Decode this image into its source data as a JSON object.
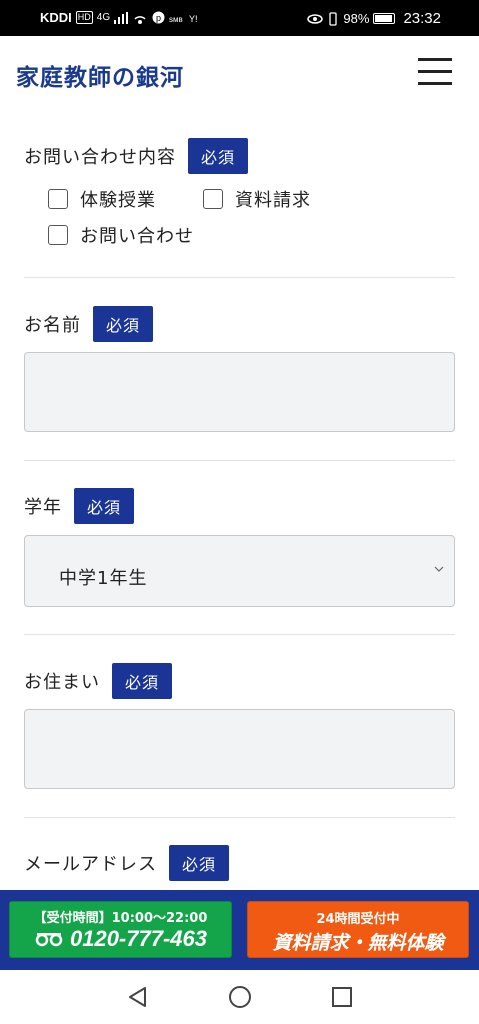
{
  "status_bar": {
    "carrier": "KDDI",
    "hd": "HD",
    "network": "4G",
    "battery_percent": "98%",
    "time": "23:32"
  },
  "header": {
    "logo": "家庭教師の銀河",
    "menu_icon": "hamburger-icon"
  },
  "form": {
    "required_label": "必須",
    "inquiry": {
      "label": "お問い合わせ内容",
      "options": [
        "体験授業",
        "資料請求",
        "お問い合わせ"
      ],
      "checked": [
        false,
        false,
        false
      ]
    },
    "name": {
      "label": "お名前",
      "value": ""
    },
    "grade": {
      "label": "学年",
      "selected": "中学1年生"
    },
    "address": {
      "label": "お住まい",
      "value": ""
    },
    "email": {
      "label": "メールアドレス"
    }
  },
  "cta": {
    "phone_hours": "【受付時間】10:00〜22:00",
    "phone_number": "0120-777-463",
    "phone_icon": "freedial-icon",
    "request_sub": "24時間受付中",
    "request_main": "資料請求・無料体験"
  },
  "colors": {
    "brand": "#1a3a8f",
    "required_badge": "#1a3595",
    "phone_button": "#14a54b",
    "request_button": "#f05a12"
  },
  "nav": {
    "back_icon": "back-triangle-icon",
    "home_icon": "home-circle-icon",
    "recents_icon": "recents-square-icon"
  }
}
